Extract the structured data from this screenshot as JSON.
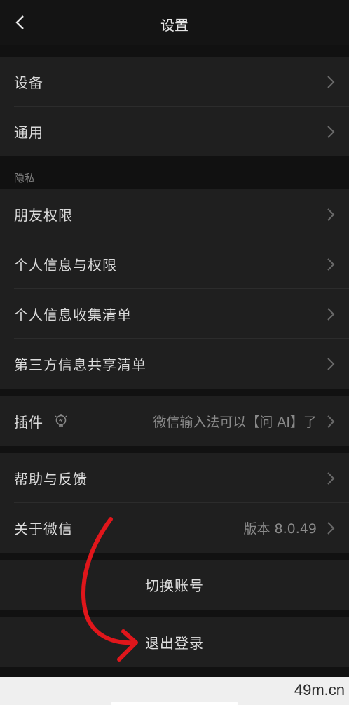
{
  "header": {
    "title": "设置",
    "back_icon": "chevron-left-icon"
  },
  "group1": [
    {
      "label": "设备"
    },
    {
      "label": "通用"
    }
  ],
  "privacy": {
    "section_title": "隐私",
    "items": [
      {
        "label": "朋友权限"
      },
      {
        "label": "个人信息与权限"
      },
      {
        "label": "个人信息收集清单"
      },
      {
        "label": "第三方信息共享清单"
      }
    ]
  },
  "plugin": {
    "label": "插件",
    "icon": "plugin-bulb-icon",
    "value": "微信输入法可以【问 AI】了"
  },
  "group3": [
    {
      "label": "帮助与反馈",
      "value": ""
    },
    {
      "label": "关于微信",
      "value": "版本 8.0.49"
    }
  ],
  "switch_account": "切换账号",
  "logout": "退出登录",
  "watermark": "49m.cn",
  "colors": {
    "background": "#111111",
    "cell": "#1f1f1f",
    "annotation_arrow": "#e0161b"
  }
}
